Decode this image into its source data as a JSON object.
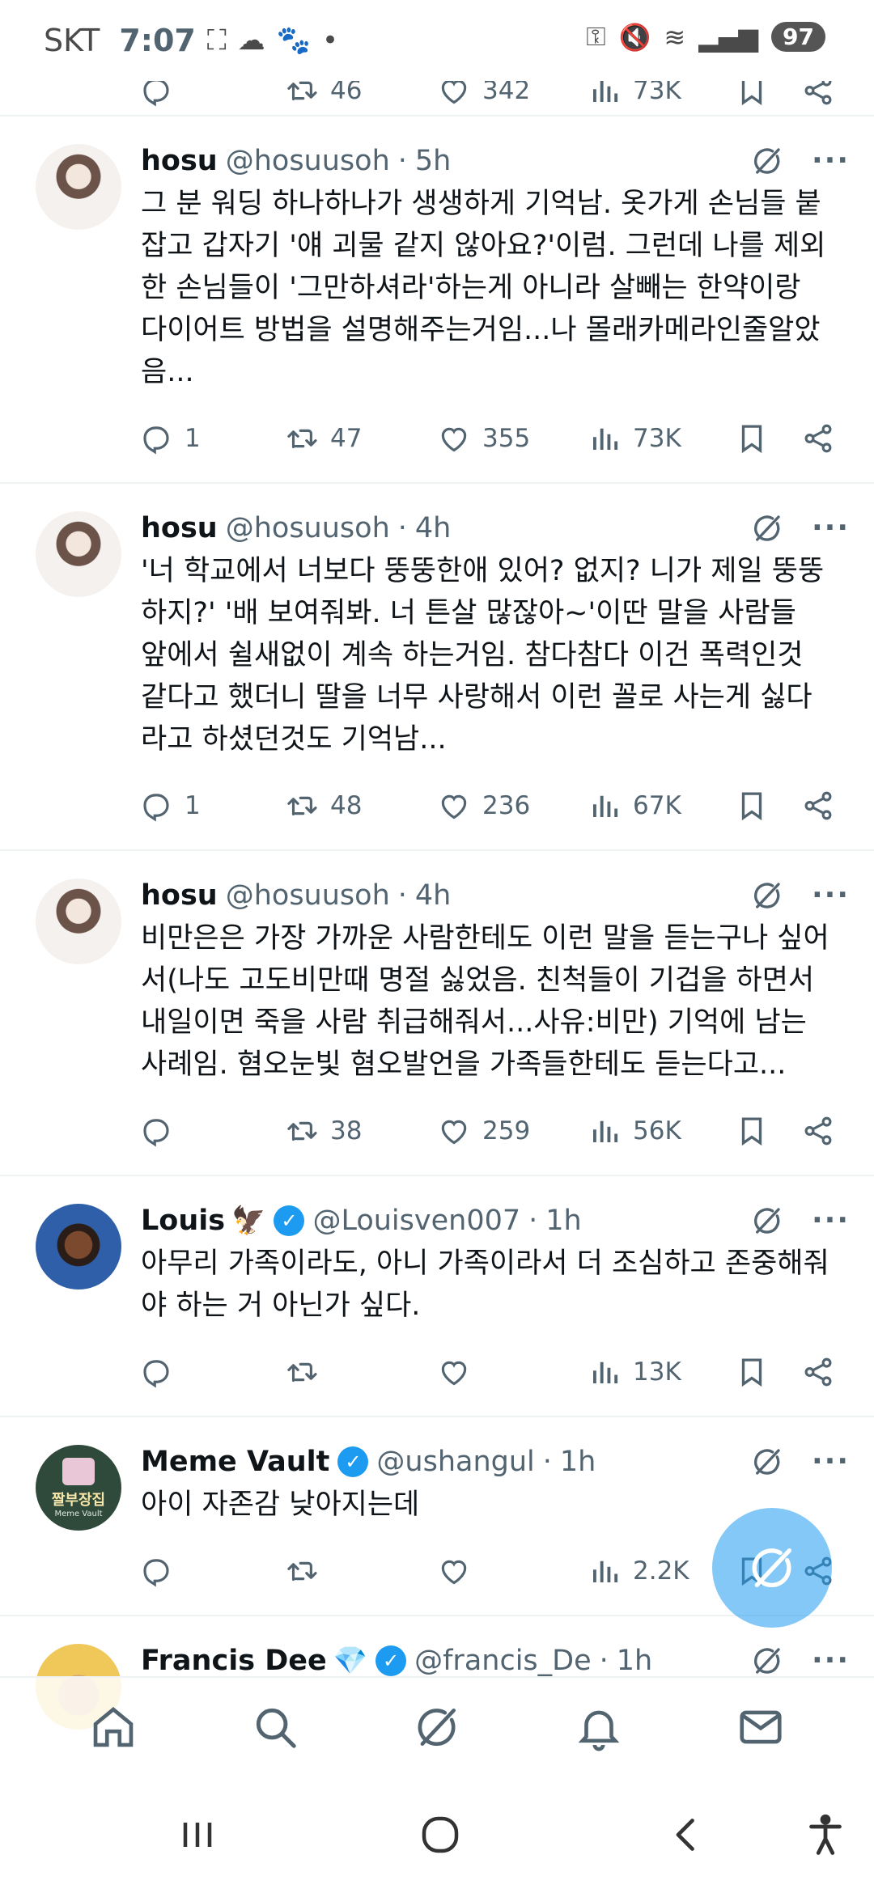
{
  "status_bar": {
    "carrier": "SKT",
    "time": "7:07",
    "battery": "97"
  },
  "partial_tweet": {
    "retweets": "46",
    "likes": "342",
    "views": "73K"
  },
  "tweets": [
    {
      "name": "hosu",
      "handle": "@hosuusoh",
      "time": "5h",
      "text": "그 분 워딩 하나하나가 생생하게 기억남. 옷가게 손님들 붙잡고 갑자기 '얘 괴물 같지 않아요?'이럼. 그런데 나를 제외한 손님들이 '그만하셔라'하는게 아니라 살빼는 한약이랑 다이어트 방법을 설명해주는거임...나 몰래카메라인줄알았음...",
      "replies": "1",
      "retweets": "47",
      "likes": "355",
      "views": "73K"
    },
    {
      "name": "hosu",
      "handle": "@hosuusoh",
      "time": "4h",
      "text": "'너 학교에서 너보다 뚱뚱한애 있어? 없지? 니가 제일 뚱뚱하지?' '배 보여줘봐. 너 튼살 많잖아~'이딴 말을 사람들 앞에서 쉴새없이 계속 하는거임. 참다참다 이건 폭력인것 같다고 했더니 딸을 너무 사랑해서 이런 꼴로 사는게 싫다라고 하셨던것도 기억남...",
      "replies": "1",
      "retweets": "48",
      "likes": "236",
      "views": "67K"
    },
    {
      "name": "hosu",
      "handle": "@hosuusoh",
      "time": "4h",
      "text": "비만은은 가장 가까운 사람한테도 이런 말을 듣는구나 싶어서(나도 고도비만때 명절 싫었음. 친척들이 기겁을 하면서 내일이면 죽을 사람 취급해줘서...사유:비만) 기억에 남는 사례임. 혐오눈빛 혐오발언을 가족들한테도 듣는다고...",
      "replies": "",
      "retweets": "38",
      "likes": "259",
      "views": "56K"
    },
    {
      "name": "Louis",
      "emoji": "🦅",
      "handle": "@Louisven007",
      "time": "1h",
      "text": "아무리 가족이라도, 아니 가족이라서 더 조심하고 존중해줘야 하는 거 아닌가 싶다.",
      "replies": "",
      "retweets": "",
      "likes": "",
      "views": "13K"
    },
    {
      "name": "Meme Vault",
      "handle": "@ushangul",
      "time": "1h",
      "text": "아이 자존감 낮아지는데",
      "replies": "",
      "retweets": "",
      "likes": "",
      "views": "2.2K",
      "avatar_text": "짤부장집",
      "avatar_sub": "Meme Vault"
    },
    {
      "name": "Francis Dee",
      "emoji": "💎",
      "handle": "@francis_De",
      "time": "1h"
    }
  ],
  "colors": {
    "accent": "#1d9bf0",
    "muted": "#536471",
    "text": "#0f1419",
    "divider": "#eff3f4"
  },
  "icons": {
    "reply": "reply-icon",
    "retweet": "retweet-icon",
    "like": "heart-icon",
    "views": "views-icon",
    "bookmark": "bookmark-icon",
    "share": "share-icon",
    "grok": "grok-icon",
    "more": "more-icon"
  }
}
